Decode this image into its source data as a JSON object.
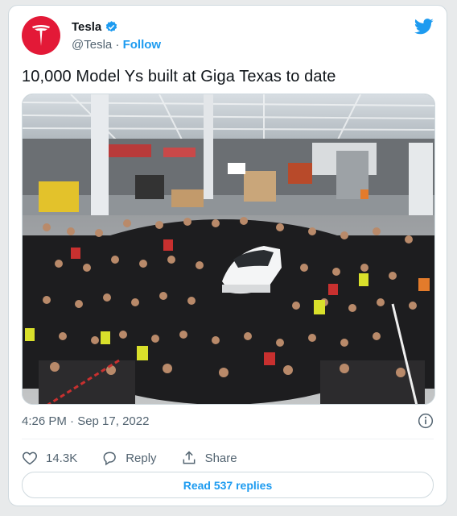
{
  "author": {
    "name": "Tesla",
    "handle": "@Tesla",
    "separator": " · ",
    "follow_label": "Follow",
    "verified": true,
    "avatar_color": "#e31937"
  },
  "tweet": {
    "text": "10,000 Model Ys built at Giga Texas to date",
    "image_alt": "Large crowd of Giga Texas workers posing around a white Model Y on the factory floor",
    "timestamp": "4:26 PM · Sep 17, 2022"
  },
  "actions": {
    "likes": "14.3K",
    "reply_label": "Reply",
    "share_label": "Share"
  },
  "read_replies_label": "Read 537 replies",
  "colors": {
    "accent": "#1d9bf0",
    "secondary_text": "#536471",
    "border": "#cfd9de"
  },
  "icons": [
    "tesla-logo-icon",
    "verified-badge-icon",
    "twitter-bird-icon",
    "info-icon",
    "heart-icon",
    "reply-bubble-icon",
    "share-icon"
  ]
}
